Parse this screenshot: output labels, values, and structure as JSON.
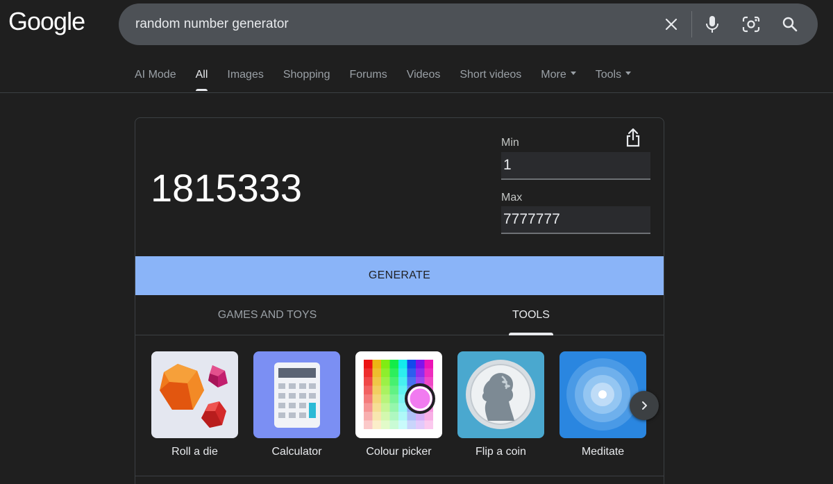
{
  "logo": "Google",
  "search": {
    "query": "random number generator",
    "icons": [
      "close-icon",
      "mic-icon",
      "lens-icon",
      "search-icon"
    ]
  },
  "tabs": [
    {
      "label": "AI Mode",
      "active": false
    },
    {
      "label": "All",
      "active": true
    },
    {
      "label": "Images",
      "active": false
    },
    {
      "label": "Shopping",
      "active": false
    },
    {
      "label": "Forums",
      "active": false
    },
    {
      "label": "Videos",
      "active": false
    },
    {
      "label": "Short videos",
      "active": false
    },
    {
      "label": "More",
      "active": false,
      "dropdown": true
    },
    {
      "label": "Tools",
      "active": false,
      "dropdown": true
    }
  ],
  "rng": {
    "result": "1815333",
    "min_label": "Min",
    "min_value": "1",
    "max_label": "Max",
    "max_value": "7777777",
    "generate_label": "GENERATE"
  },
  "subtabs": {
    "games": "GAMES AND TOYS",
    "tools": "TOOLS",
    "active": "tools"
  },
  "tiles": [
    {
      "label": "Roll a die",
      "icon": "dice-icon"
    },
    {
      "label": "Calculator",
      "icon": "calculator-icon"
    },
    {
      "label": "Colour picker",
      "icon": "colour-picker-icon"
    },
    {
      "label": "Flip a coin",
      "icon": "coin-icon"
    },
    {
      "label": "Meditate",
      "icon": "meditate-icon"
    }
  ],
  "colors": {
    "background": "#1f1f1f",
    "search_bar": "#4d5156",
    "generate_button": "#8ab4f8",
    "calculator_tile": "#7b8ff3",
    "coin_tile": "#4aa8cf",
    "meditate_tile": "#2a86e0"
  }
}
